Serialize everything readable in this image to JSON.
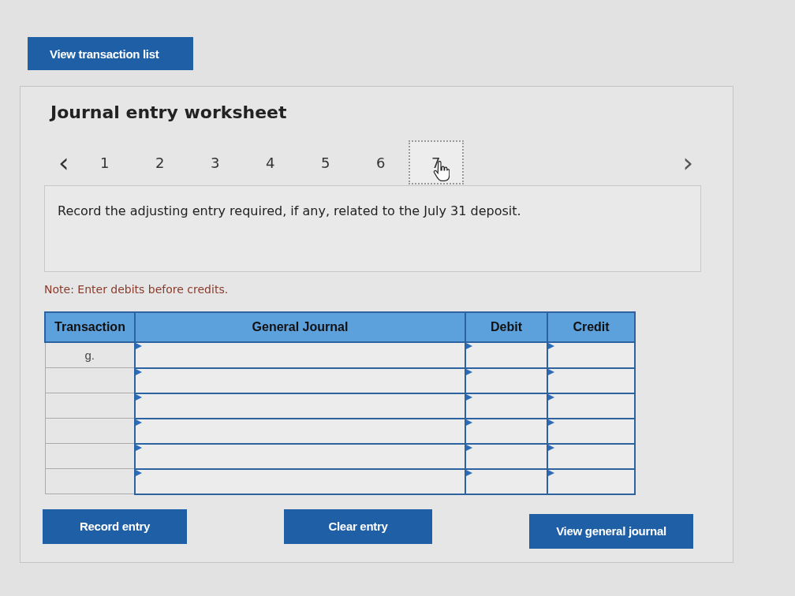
{
  "top_button": "View transaction list",
  "worksheet": {
    "title": "Journal entry worksheet",
    "pages": [
      {
        "label": "1",
        "selected": false
      },
      {
        "label": "2",
        "selected": false
      },
      {
        "label": "3",
        "selected": false
      },
      {
        "label": "4",
        "selected": false
      },
      {
        "label": "5",
        "selected": false
      },
      {
        "label": "6",
        "selected": false
      },
      {
        "label": "7",
        "selected": true
      }
    ],
    "prev": "‹",
    "next": "›",
    "instruction": "Record the adjusting entry required, if any, related to the July 31 deposit.",
    "note": "Note: Enter debits before credits.",
    "table": {
      "columns": [
        "Transaction",
        "General Journal",
        "Debit",
        "Credit"
      ],
      "rows": [
        {
          "transaction": "g."
        },
        {},
        {},
        {},
        {},
        {}
      ]
    },
    "buttons": [
      "Record entry",
      "Clear entry",
      "View general journal"
    ]
  }
}
